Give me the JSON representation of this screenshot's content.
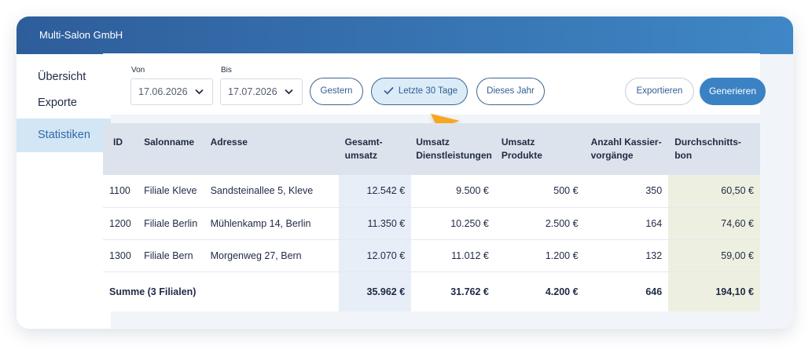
{
  "app": {
    "title": "Multi-Salon GmbH"
  },
  "sidebar": {
    "items": [
      {
        "label": "Übersicht",
        "active": false
      },
      {
        "label": "Exporte",
        "active": false
      },
      {
        "label": "Statistiken",
        "active": true
      }
    ]
  },
  "filters": {
    "from_label": "Von",
    "from_value": "17.06.2026",
    "to_label": "Bis",
    "to_value": "17.07.2026",
    "quick": [
      {
        "label": "Gestern",
        "selected": false
      },
      {
        "label": "Letzte 30 Tage",
        "selected": true
      },
      {
        "label": "Dieses Jahr",
        "selected": false
      }
    ],
    "export_label": "Exportieren",
    "generate_label": "Generieren"
  },
  "table": {
    "headers": {
      "id": "ID",
      "name": "Salonname",
      "address": "Adresse",
      "total_1": "Gesamt-",
      "total_2": "umsatz",
      "services_1": "Umsatz",
      "services_2": "Dienstleistungen",
      "products_1": "Umsatz",
      "products_2": "Produkte",
      "transactions_1": "Anzahl Kassier-",
      "transactions_2": "vorgänge",
      "avg_1": "Durchschnitts-",
      "avg_2": "bon"
    },
    "rows": [
      {
        "id": "1100",
        "name": "Filiale Kleve",
        "address": "Sandsteinallee 5, Kleve",
        "total": "12.542 €",
        "services": "9.500 €",
        "products": "500 €",
        "transactions": "350",
        "avg": "60,50 €"
      },
      {
        "id": "1200",
        "name": "Filiale Berlin",
        "address": "Mühlenkamp 14, Berlin",
        "total": "11.350 €",
        "services": "10.250 €",
        "products": "2.500 €",
        "transactions": "164",
        "avg": "74,60 €"
      },
      {
        "id": "1300",
        "name": "Filiale Bern",
        "address": "Morgenweg 27, Bern",
        "total": "12.070 €",
        "services": "11.012 €",
        "products": "1.200 €",
        "transactions": "132",
        "avg": "59,00 €"
      }
    ],
    "sum": {
      "label": "Summe (3 Filialen)",
      "total": "35.962 €",
      "services": "31.762 €",
      "products": "4.200 €",
      "transactions": "646",
      "avg": "194,10 €"
    }
  },
  "colors": {
    "header_gradient_start": "#2e5d9a",
    "header_gradient_end": "#3f87c6",
    "accent": "#3b82c4",
    "cursor": "#f5a623",
    "highlight_total": "#e8eef7",
    "highlight_avg": "#edf0e1"
  },
  "icons": [
    "chevron-down-icon",
    "check-icon",
    "pointer-cursor-icon"
  ]
}
